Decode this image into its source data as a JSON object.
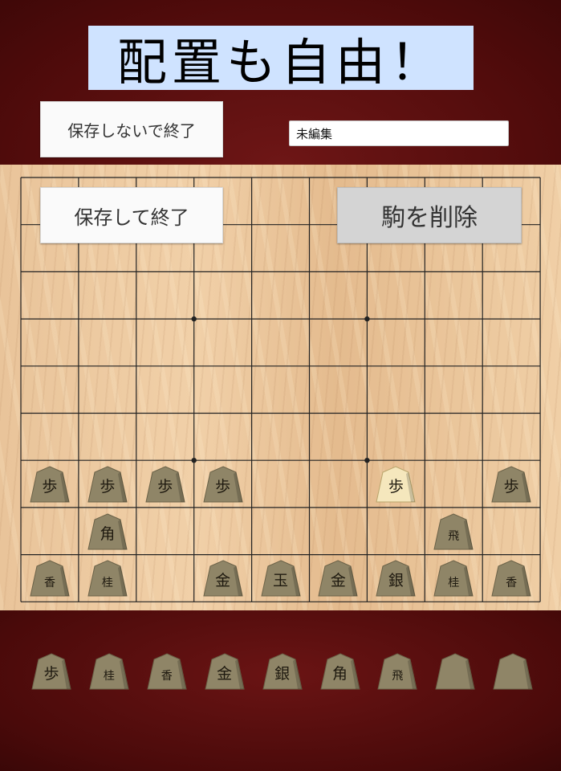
{
  "headline": "配置も自由！",
  "buttons": {
    "exit_without_save": "保存しないで終了",
    "save_and_exit": "保存して終了",
    "delete_piece": "駒を削除"
  },
  "record_name": {
    "value": "未編集"
  },
  "colors": {
    "piece_face": "#8f8567",
    "piece_selected": "#f5e7bd",
    "board_line": "#222222",
    "headline_bg": "#cfe3ff"
  },
  "board": {
    "files": 9,
    "ranks": 9,
    "pieces": [
      {
        "file": 9,
        "rank": 7,
        "label": "歩"
      },
      {
        "file": 8,
        "rank": 7,
        "label": "歩"
      },
      {
        "file": 7,
        "rank": 7,
        "label": "歩"
      },
      {
        "file": 6,
        "rank": 7,
        "label": "歩"
      },
      {
        "file": 3,
        "rank": 7,
        "label": "歩",
        "selected": true
      },
      {
        "file": 1,
        "rank": 7,
        "label": "歩"
      },
      {
        "file": 8,
        "rank": 8,
        "label": "角"
      },
      {
        "file": 2,
        "rank": 8,
        "label": "飛"
      },
      {
        "file": 9,
        "rank": 9,
        "label": "香"
      },
      {
        "file": 8,
        "rank": 9,
        "label": "桂"
      },
      {
        "file": 6,
        "rank": 9,
        "label": "金"
      },
      {
        "file": 5,
        "rank": 9,
        "label": "玉"
      },
      {
        "file": 4,
        "rank": 9,
        "label": "金"
      },
      {
        "file": 3,
        "rank": 9,
        "label": "銀"
      },
      {
        "file": 2,
        "rank": 9,
        "label": "桂"
      },
      {
        "file": 1,
        "rank": 9,
        "label": "香"
      }
    ]
  },
  "tray": {
    "pieces": [
      {
        "label": "歩"
      },
      {
        "label": "桂"
      },
      {
        "label": "香"
      },
      {
        "label": "金"
      },
      {
        "label": "銀"
      },
      {
        "label": "角"
      },
      {
        "label": "飛"
      },
      {
        "label": ""
      },
      {
        "label": ""
      }
    ]
  }
}
